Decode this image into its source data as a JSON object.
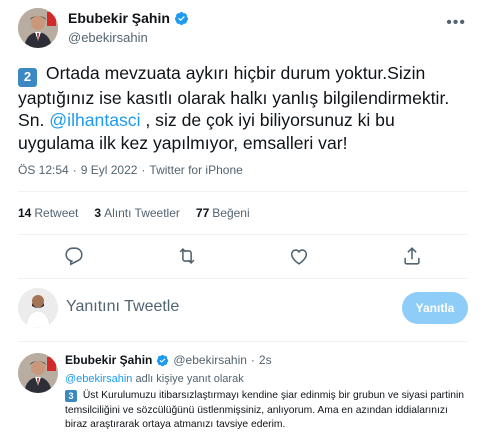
{
  "tweet": {
    "author_name": "Ebubekir Şahin",
    "author_handle": "@ebekirsahin",
    "badge": "2",
    "text_before": " Ortada mevzuata aykırı hiçbir durum yoktur.Sizin yaptığınız ise kasıtlı olarak halkı yanlış bilgilendirmektir. Sn. ",
    "mention": "@ilhantasci",
    "text_after": " , siz de çok iyi biliyorsunuz ki bu uygulama ilk kez yapılmıyor, emsalleri var!",
    "time": "ÖS 12:54",
    "date": "9 Eyl 2022",
    "source": "Twitter for iPhone",
    "separator": "·"
  },
  "stats": {
    "retweets_count": "14",
    "retweets_label": "Retweet",
    "quotes_count": "3",
    "quotes_label": "Alıntı Tweetler",
    "likes_count": "77",
    "likes_label": "Beğeni"
  },
  "reply_compose": {
    "placeholder": "Yanıtını Tweetle",
    "button_label": "Yanıtla"
  },
  "reply_tweet": {
    "author_name": "Ebubekir Şahin",
    "author_handle": "@ebekirsahin",
    "time_ago": "2s",
    "separator": "·",
    "replying_mention": "@ebekirsahin",
    "replying_suffix": " adlı kişiye yanıt olarak",
    "badge": "3",
    "text": " Üst Kurulumuzu itibarsızlaştırmayı kendine şiar edinmiş bir grubun ve siyasi partinin temsilciliğini ve sözcülüğünü üstlenmişsiniz, anlıyorum. Ama en azından iddialarınızı biraz araştırarak ortaya atmanızı tavsiye ederim."
  },
  "icons": {
    "more": "more-icon",
    "verified": "verified-badge-icon",
    "reply": "reply-icon",
    "retweet": "retweet-icon",
    "like": "like-icon",
    "share": "share-icon"
  },
  "colors": {
    "accent": "#1d9bf0",
    "verified": "#1d9bf0",
    "muted": "#536471",
    "reply_button_disabled": "#8ecdf7",
    "number_badge": "#3b88c3"
  }
}
